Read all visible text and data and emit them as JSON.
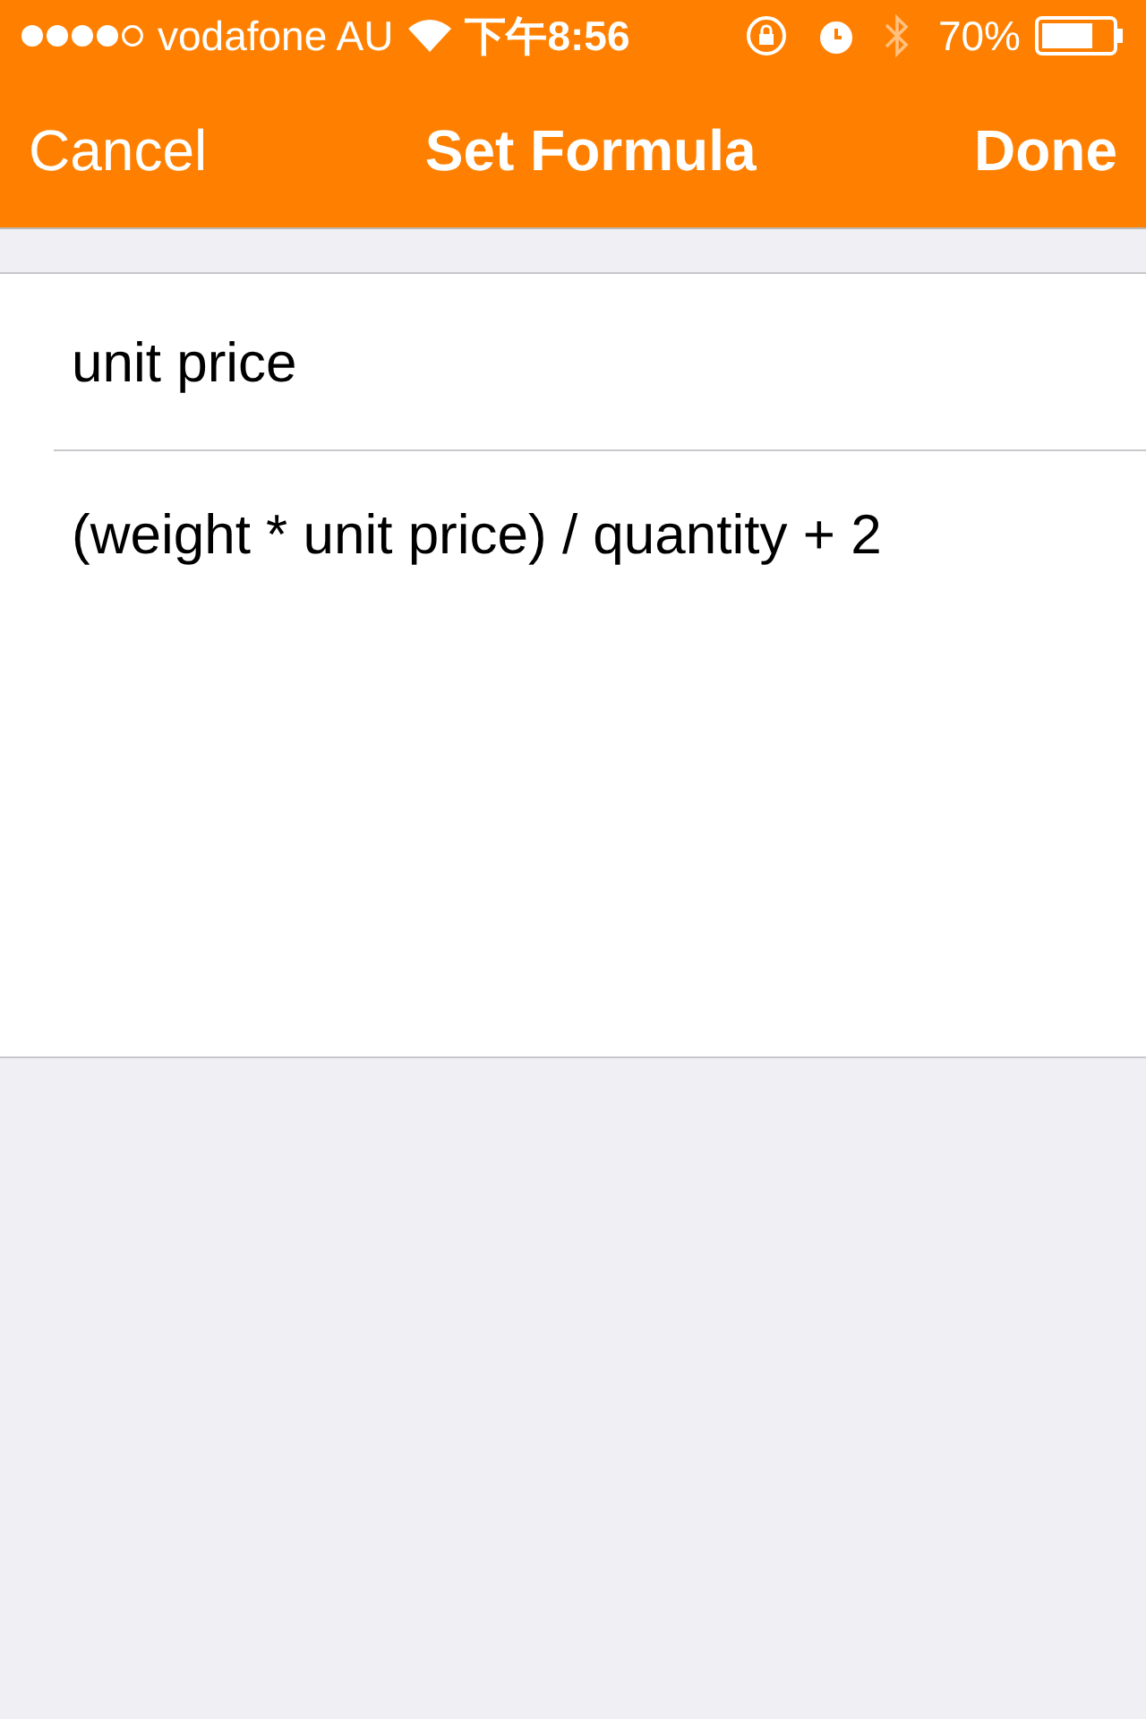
{
  "status_bar": {
    "carrier": "vodafone AU",
    "time": "下午8:56",
    "battery": "70%"
  },
  "nav_bar": {
    "left_button": "Cancel",
    "title": "Set Formula",
    "right_button": "Done"
  },
  "form": {
    "name_field": {
      "value": "unit price"
    },
    "formula_field": {
      "value": "(weight * unit price) / quantity + 2"
    }
  }
}
